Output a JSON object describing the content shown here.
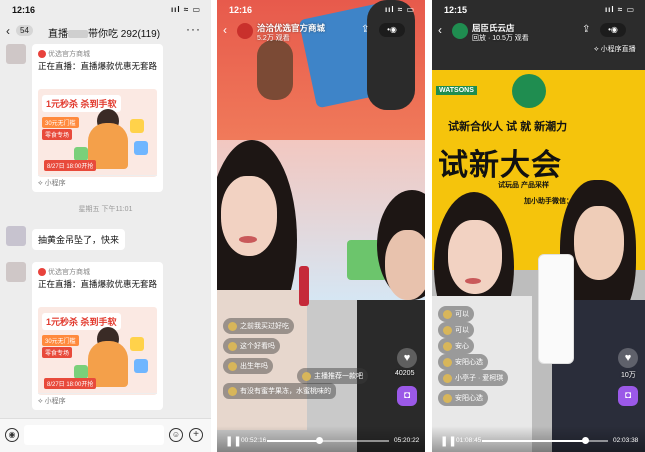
{
  "chat": {
    "status": {
      "time": "12:16",
      "signal": "ııl ≈ ▭"
    },
    "header": {
      "back": "‹",
      "unread": "54",
      "title_prefix": "直播",
      "title_suffix": "带你吃 292(119)",
      "more": "···"
    },
    "cards": [
      {
        "source": "优选官方商城",
        "live_text": "正在直播：直播爆款优惠无套路",
        "poster": {
          "headline": "1元秒杀 杀到手软",
          "line2": "30元无门槛",
          "line3": "零食专场",
          "line4": "8/27日 18:00开抢"
        },
        "mini_program": "小程序"
      },
      {
        "source": "优选官方商城",
        "live_text": "正在直播：直播爆款优惠无套路",
        "poster": {
          "headline": "1元秒杀 杀到手软",
          "line2": "30元无门槛",
          "line3": "零食专场",
          "line4": "8/27日 18:00开抢"
        },
        "mini_program": "小程序"
      }
    ],
    "timestamp": "星期五 下午11:01",
    "message": "抽黄金吊坠了，快来",
    "input": {
      "voice_icon": "◉",
      "emoji_icon": "☺",
      "plus_icon": "+"
    }
  },
  "live1": {
    "status": {
      "time": "12:16",
      "signal": "ııl ≈ ▭"
    },
    "header": {
      "back": "‹",
      "name": "洽洽优选官方商城",
      "viewers": "5.2万 观看",
      "share": "⇪",
      "dots": "•◉"
    },
    "comments": [
      {
        "text": "之前我买过好吃"
      },
      {
        "text": "这个好看吗"
      },
      {
        "text": "出生年吗"
      },
      {
        "text": "主播推荐一款吧"
      },
      {
        "text": "有没有蜜芋果冻，水蜜桃味的"
      }
    ],
    "like_count": "40205",
    "player": {
      "current": "00:52:16",
      "total": "05:20:22",
      "progress": 0.43
    }
  },
  "live2": {
    "status": {
      "time": "12:15",
      "signal": "ııl ≈ ▭"
    },
    "header": {
      "back": "‹",
      "name": "屈臣氏云店",
      "viewers": "回放 · 10.5万 观看",
      "share": "⇪",
      "dots": "•◉"
    },
    "mini_program": "小程序直播",
    "banner": {
      "top": "试新合伙人 试 就 新潮力",
      "main": "试新大会",
      "sub": "试玩品 产品采样",
      "follow": "加小助手微信：wat"
    },
    "brand": "WATSONS",
    "comments": [
      {
        "text": "可以"
      },
      {
        "text": "可以"
      },
      {
        "text": "安心"
      },
      {
        "text": "安阳心选"
      },
      {
        "text": "小亭子 · 爱柯琪"
      },
      {
        "text": "安阳心选"
      }
    ],
    "like_count": "10万",
    "player": {
      "current": "01:08:45",
      "total": "02:03:38",
      "progress": 0.82
    }
  }
}
